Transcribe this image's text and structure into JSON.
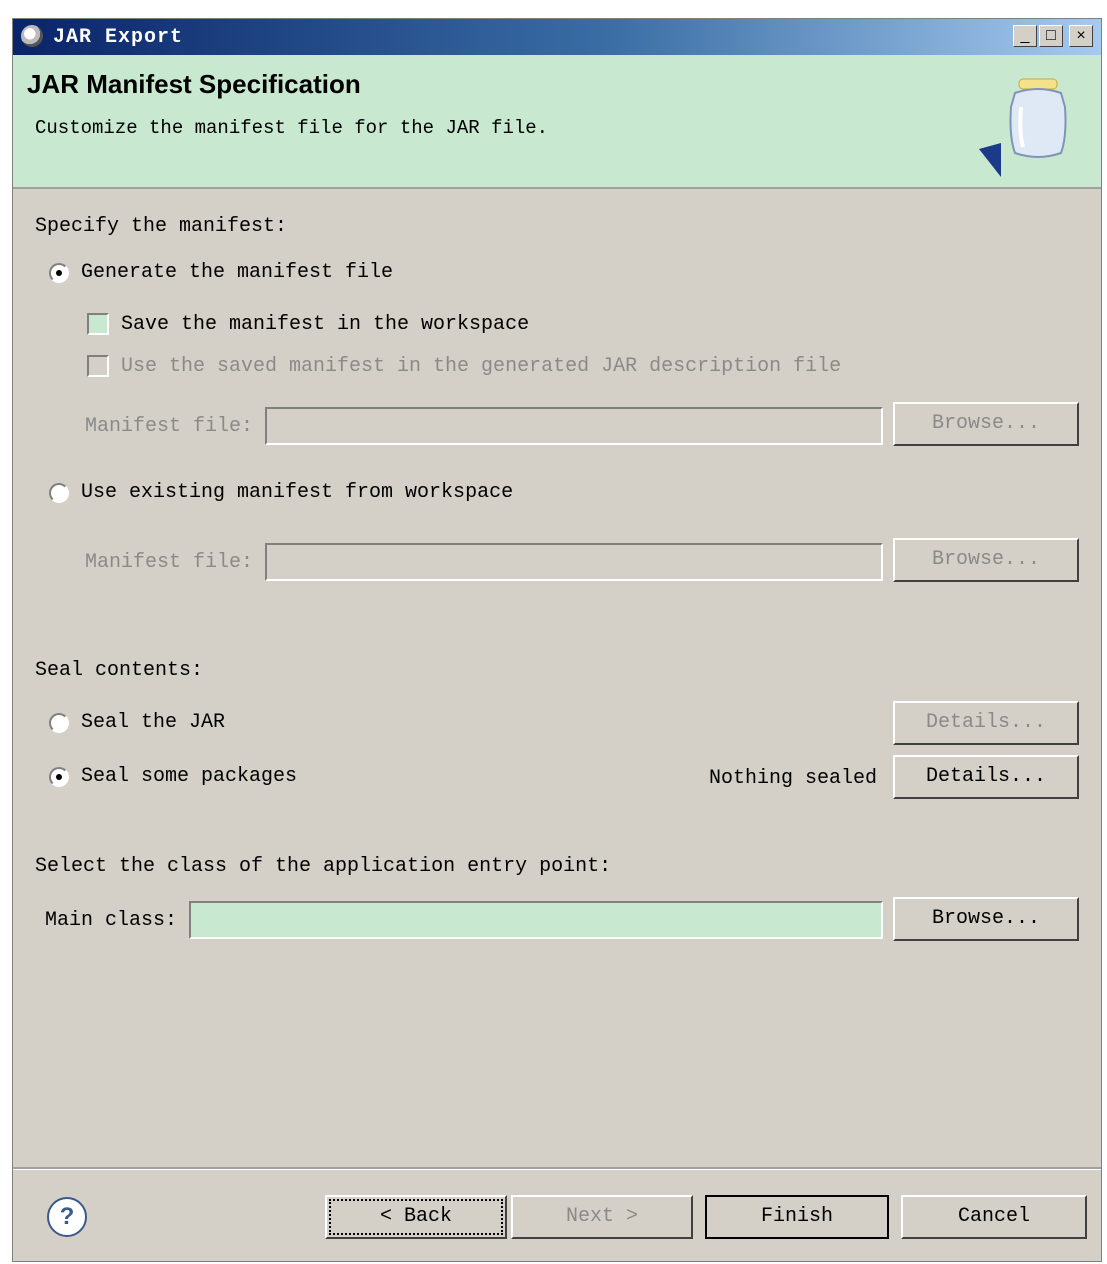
{
  "window": {
    "title": "JAR Export",
    "minimize": "_",
    "maximize": "□",
    "close": "×"
  },
  "banner": {
    "title": "JAR Manifest Specification",
    "description": "Customize the manifest file for the JAR file."
  },
  "manifest": {
    "section_label": "Specify the manifest:",
    "generate_label": "Generate the manifest file",
    "save_label": "Save the manifest in the workspace",
    "use_saved_label": "Use the saved manifest in the generated JAR description file",
    "manifest_file_label": "Manifest file:",
    "manifest_file_value": "",
    "browse_label": "Browse...",
    "use_existing_label": "Use existing manifest from workspace",
    "existing_file_label": "Manifest file:",
    "existing_file_value": "",
    "existing_browse_label": "Browse..."
  },
  "seal": {
    "section_label": "Seal contents:",
    "seal_jar_label": "Seal the JAR",
    "seal_jar_details": "Details...",
    "seal_some_label": "Seal some packages",
    "status": "Nothing sealed",
    "seal_some_details": "Details..."
  },
  "entry": {
    "section_label": "Select the class of the application entry point:",
    "main_class_label": "Main class:",
    "main_class_value": "",
    "browse_label": "Browse..."
  },
  "footer": {
    "help": "?",
    "back": "< Back",
    "next": "Next >",
    "finish": "Finish",
    "cancel": "Cancel"
  }
}
